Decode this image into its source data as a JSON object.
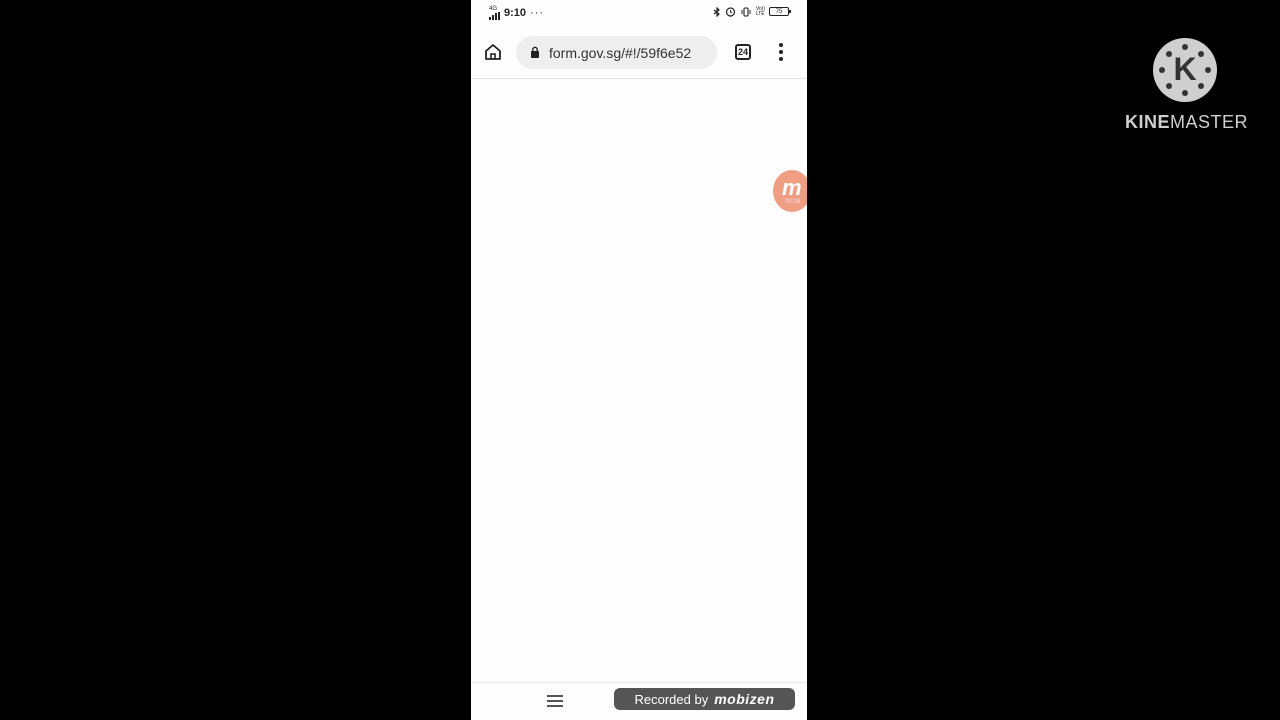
{
  "status_bar": {
    "network": "4G",
    "time": "9:10",
    "overflow_dots": "···",
    "volte": "Vo))",
    "lte": "LTE",
    "battery_level": "75",
    "icons": [
      "bluetooth-icon",
      "alarm-icon",
      "vibrate-icon",
      "volte-lte-icon",
      "battery-icon"
    ]
  },
  "browser": {
    "url": "form.gov.sg/#!/59f6e52",
    "tab_count": "24",
    "icons": [
      "home-icon",
      "lock-icon",
      "tabs-icon",
      "more-vert-icon"
    ]
  },
  "bottom_nav": {
    "icons": [
      "menu-icon"
    ]
  },
  "recorder": {
    "bubble_letter": "m",
    "bubble_timer": "00:09",
    "watermark_prefix": "Recorded by",
    "watermark_brand": "mobizen"
  },
  "kinemaster": {
    "brand_bold": "KINE",
    "brand_light": "MASTER",
    "logo_letter": "K"
  },
  "colors": {
    "outer_background": "#000000",
    "page_background": "#fdfdfd",
    "url_bar": "#eeeeee",
    "bubble": "#ef9d83"
  }
}
